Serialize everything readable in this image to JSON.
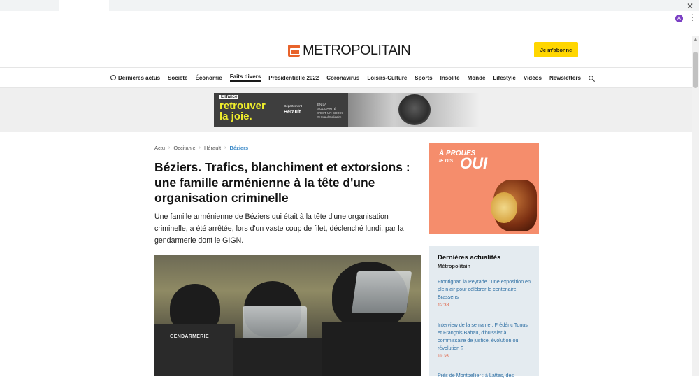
{
  "browser": {
    "close_glyph": "✕",
    "avatar_letter": "A",
    "menu_glyph": "⋮"
  },
  "header": {
    "logo_text": "METROPOLITAIN",
    "subscribe_label": "Je m'abonne"
  },
  "nav": {
    "items": [
      "Dernières actus",
      "Société",
      "Économie",
      "Faits divers",
      "Présidentielle 2022",
      "Coronavirus",
      "Loisirs-Culture",
      "Sports",
      "Insolite",
      "Monde",
      "Lifestyle",
      "Vidéos",
      "Newsletters"
    ],
    "active": "Faits divers"
  },
  "banner_ad": {
    "tag": "Enfance",
    "headline_1": "retrouver",
    "headline_2": "la joie.",
    "department_top": "Département",
    "department": "Hérault",
    "side_text": "EN LA SOLIDARITÉ C'EST UN CHOIX #HeraultSolidaire"
  },
  "breadcrumb": [
    "Actu",
    "Occitanie",
    "Hérault",
    "Béziers"
  ],
  "article": {
    "title": "Béziers. Trafics, blanchiment et extorsions : une famille arménienne à la tête d'une organisation criminelle",
    "lede": "Une famille arménienne de Béziers qui était à la tête d'une organisation criminelle, a été arrêtée, lors d'un vaste coup de filet, déclenché lundi, par la gendarmerie dont le GIGN.",
    "hero_label": "GENDARMERIE"
  },
  "side_ad": {
    "line1": "À PROUES",
    "line2": "JE DIS",
    "line3": "OUI"
  },
  "latest_news": {
    "heading": "Dernières actualités",
    "source": "Métropolitain",
    "items": [
      {
        "title": "Frontignan la Peyrade : une exposition en plein air pour célébrer le centenaire Brassens",
        "time": "12:38"
      },
      {
        "title": "Interview de la semaine : Frédéric Tonus et François Babau, d'huissier à commissaire de justice, évolution ou révolution ?",
        "time": "11:35"
      },
      {
        "title": "Près de Montpellier : à Lattes, des",
        "time": ""
      }
    ]
  }
}
